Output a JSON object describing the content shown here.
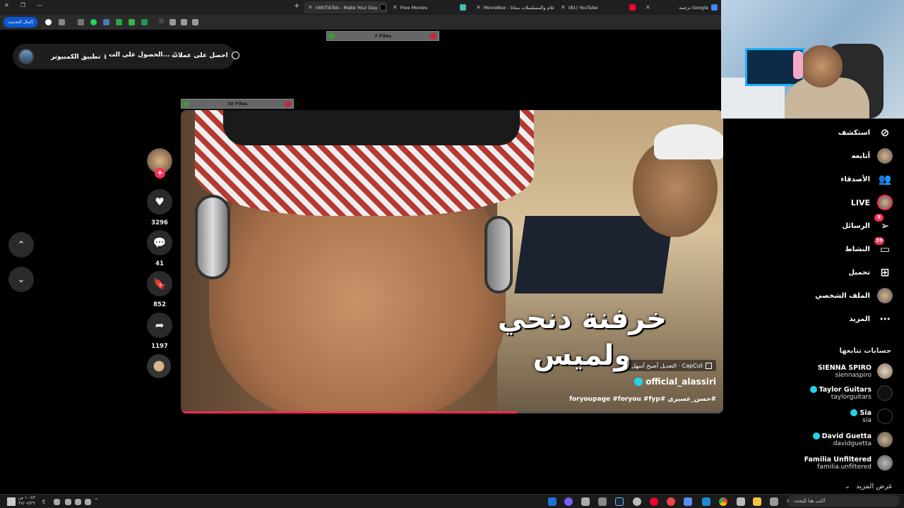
{
  "tabs": [
    {
      "label": "(48)TikTok - Make Your Day",
      "active": true
    },
    {
      "label": "Free Movies",
      "active": false
    },
    {
      "label": "MovieBox - أفلام والمسلسلات مجانا",
      "active": false
    },
    {
      "label": "(81) YouTube",
      "active": false
    },
    {
      "label": "ترجمة Google",
      "active": false
    }
  ],
  "toolbar": {
    "update_label": "إكمال التحديث"
  },
  "top_pill": {
    "coins_label": "احصل على عملات",
    "get_app_label": "الحصول على الت...",
    "desktop_app_label": "تطبيق الكمبيوتر"
  },
  "files_panels": {
    "top": "7 Files",
    "video": "10 Files"
  },
  "video": {
    "caption_line1": "خرفنة دنحي",
    "caption_line2": "ولميس",
    "capcut_label": "CapCut · التعديل أصبح أسهل",
    "author": "official_alassiri",
    "hashtags": "#حسن_عسيري #foryoupage #foryou #fyp",
    "progress": 0.62
  },
  "actions": {
    "likes": "3296",
    "comments": "41",
    "saves": "852",
    "shares": "1197"
  },
  "sidebar": {
    "nav": [
      {
        "label": "استكشف",
        "icon": "compass-icon"
      },
      {
        "label": "أتابعه",
        "icon": "avatar"
      },
      {
        "label": "الأصدقاء",
        "icon": "friends-icon"
      },
      {
        "label": "LIVE",
        "icon": "live-icon"
      },
      {
        "label": "الرسائل",
        "icon": "send-icon",
        "badge": "9"
      },
      {
        "label": "النشاط",
        "icon": "inbox-icon",
        "badge": "39"
      },
      {
        "label": "تحميل",
        "icon": "plus-square-icon"
      },
      {
        "label": "الملف الشخصي",
        "icon": "avatar"
      },
      {
        "label": "المزيد",
        "icon": "more-icon"
      }
    ],
    "following_title": "حسابات تتابعها",
    "accounts": [
      {
        "name": "SIENNA SPIRO",
        "handle": "siennaspiro",
        "verified": false
      },
      {
        "name": "Taylor Guitars",
        "handle": "taylorguitars",
        "verified": true
      },
      {
        "name": "Sia",
        "handle": "sia",
        "verified": true
      },
      {
        "name": "David Guetta",
        "handle": "davidguetta",
        "verified": true
      },
      {
        "name": "Familia Unfiltered",
        "handle": "familia.unfiltered",
        "verified": false
      }
    ],
    "see_more": "عرض المزيد"
  },
  "taskbar": {
    "time": "١٠:٤٣ ص",
    "date": "٢٧/٠٧/٢٩",
    "lang": "ع",
    "search_placeholder": "اكتب هنا للبحث"
  },
  "colors": {
    "accent": "#fe2c55",
    "verified": "#20d5ec",
    "chrome_blue": "#0b57d0"
  }
}
